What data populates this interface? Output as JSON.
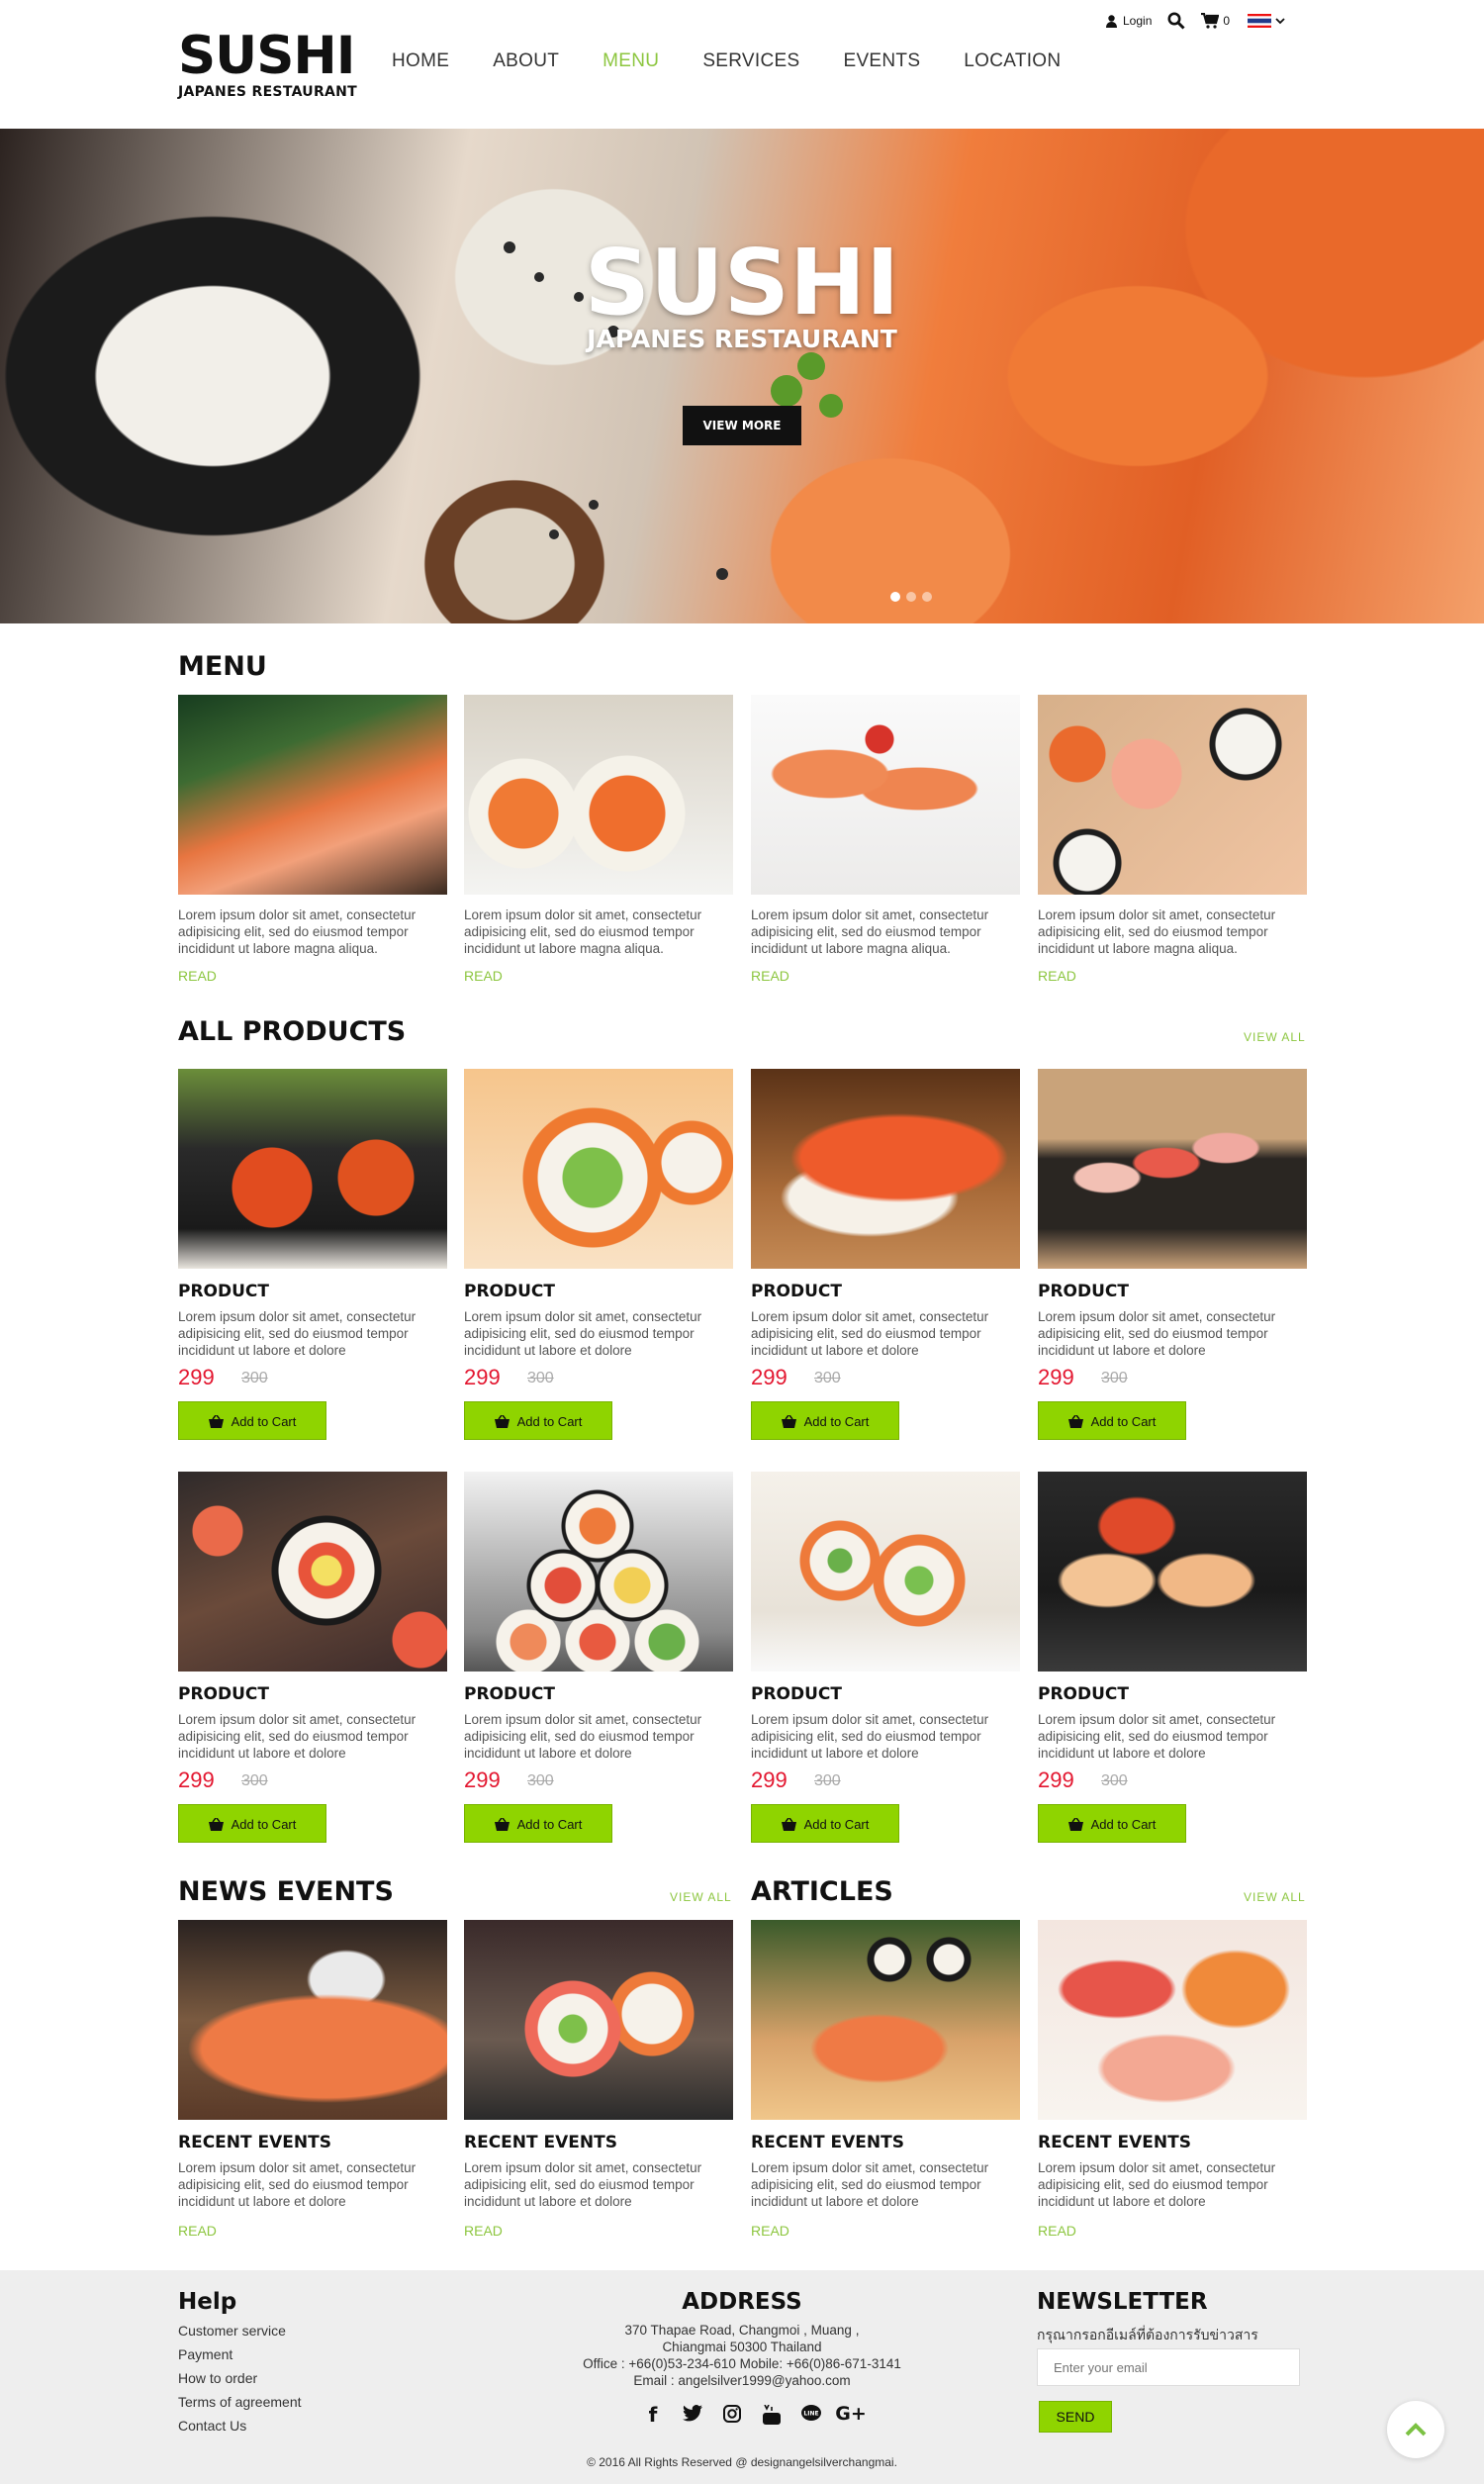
{
  "header": {
    "logo_title": "SUSHI",
    "logo_subtitle": "JAPANES RESTAURANT",
    "nav": [
      "HOME",
      "ABOUT",
      "MENU",
      "SERVICES",
      "EVENTS",
      "LOCATION"
    ],
    "active_nav": "MENU",
    "login_label": "Login",
    "cart_count": "0",
    "accent_color": "#8cc63f"
  },
  "hero": {
    "title": "SUSHI",
    "subtitle": "JAPANES RESTAURANT",
    "button": "VIEW MORE",
    "slides": 3,
    "active_slide": 1
  },
  "menu": {
    "title": "MENU",
    "items": [
      {
        "text": "Lorem ipsum dolor sit amet, consectetur adipisicing elit, sed do eiusmod tempor incididunt ut labore magna aliqua.",
        "link": "READ"
      },
      {
        "text": "Lorem ipsum dolor sit amet, consectetur adipisicing elit, sed do eiusmod tempor incididunt ut labore magna aliqua.",
        "link": "READ"
      },
      {
        "text": "Lorem ipsum dolor sit amet, consectetur adipisicing elit, sed do eiusmod tempor incididunt ut labore magna aliqua.",
        "link": "READ"
      },
      {
        "text": "Lorem ipsum dolor sit amet, consectetur adipisicing elit, sed do eiusmod tempor incididunt ut labore magna aliqua.",
        "link": "READ"
      }
    ]
  },
  "products": {
    "title": "ALL PRODUCTS",
    "view_all": "VIEW ALL",
    "items": [
      {
        "name": "PRODUCT",
        "text": "Lorem ipsum dolor sit amet, consectetur adipisicing elit, sed do eiusmod tempor incididunt ut labore et dolore",
        "price": "299",
        "old_price": "300",
        "button": "Add to Cart"
      },
      {
        "name": "PRODUCT",
        "text": "Lorem ipsum dolor sit amet, consectetur adipisicing elit, sed do eiusmod tempor incididunt ut labore et dolore",
        "price": "299",
        "old_price": "300",
        "button": "Add to Cart"
      },
      {
        "name": "PRODUCT",
        "text": "Lorem ipsum dolor sit amet, consectetur adipisicing elit, sed do eiusmod tempor incididunt ut labore et dolore",
        "price": "299",
        "old_price": "300",
        "button": "Add to Cart"
      },
      {
        "name": "PRODUCT",
        "text": "Lorem ipsum dolor sit amet, consectetur adipisicing elit, sed do eiusmod tempor incididunt ut labore et dolore",
        "price": "299",
        "old_price": "300",
        "button": "Add to Cart"
      },
      {
        "name": "PRODUCT",
        "text": "Lorem ipsum dolor sit amet, consectetur adipisicing elit, sed do eiusmod tempor incididunt ut labore et dolore",
        "price": "299",
        "old_price": "300",
        "button": "Add to Cart"
      },
      {
        "name": "PRODUCT",
        "text": "Lorem ipsum dolor sit amet, consectetur adipisicing elit, sed do eiusmod tempor incididunt ut labore et dolore",
        "price": "299",
        "old_price": "300",
        "button": "Add to Cart"
      },
      {
        "name": "PRODUCT",
        "text": "Lorem ipsum dolor sit amet, consectetur adipisicing elit, sed do eiusmod tempor incididunt ut labore et dolore",
        "price": "299",
        "old_price": "300",
        "button": "Add to Cart"
      },
      {
        "name": "PRODUCT",
        "text": "Lorem ipsum dolor sit amet, consectetur adipisicing elit, sed do eiusmod tempor incididunt ut labore et dolore",
        "price": "299",
        "old_price": "300",
        "button": "Add to Cart"
      }
    ]
  },
  "news": {
    "title": "NEWS EVENTS",
    "view_all": "VIEW ALL",
    "items": [
      {
        "name": "RECENT EVENTS",
        "text": "Lorem ipsum dolor sit amet, consectetur adipisicing elit, sed do eiusmod tempor incididunt ut labore et dolore",
        "link": "READ"
      },
      {
        "name": "RECENT EVENTS",
        "text": "Lorem ipsum dolor sit amet, consectetur adipisicing elit, sed do eiusmod tempor incididunt ut labore et dolore",
        "link": "READ"
      }
    ]
  },
  "articles": {
    "title": "ARTICLES",
    "view_all": "VIEW ALL",
    "items": [
      {
        "name": "RECENT EVENTS",
        "text": "Lorem ipsum dolor sit amet, consectetur adipisicing elit, sed do eiusmod tempor incididunt ut labore et dolore",
        "link": "READ"
      },
      {
        "name": "RECENT EVENTS",
        "text": "Lorem ipsum dolor sit amet, consectetur adipisicing elit, sed do eiusmod tempor incididunt ut labore et dolore",
        "link": "READ"
      }
    ]
  },
  "footer": {
    "help_title": "Help",
    "help_links": [
      "Customer service",
      "Payment",
      "How to order",
      "Terms of agreement",
      "Contact Us"
    ],
    "address_title": "ADDRESS",
    "address_lines": [
      "370 Thapae Road, Changmoi , Muang ,",
      "Chiangmai 50300 Thailand",
      "Office : +66(0)53-234-610  Mobile: +66(0)86-671-3141",
      "Email : angelsilver1999@yahoo.com"
    ],
    "social": [
      "facebook-icon",
      "twitter-icon",
      "instagram-icon",
      "youtube-icon",
      "line-icon",
      "google-plus-icon"
    ],
    "newsletter_title": "NEWSLETTER",
    "newsletter_text": "กรุณากรอกอีเมล์ที่ต้องการรับข่าวสาร",
    "newsletter_placeholder": "Enter your email",
    "send": "SEND",
    "copyright": "© 2016 All Rights Reserved @ designangelsilverchangmai."
  }
}
